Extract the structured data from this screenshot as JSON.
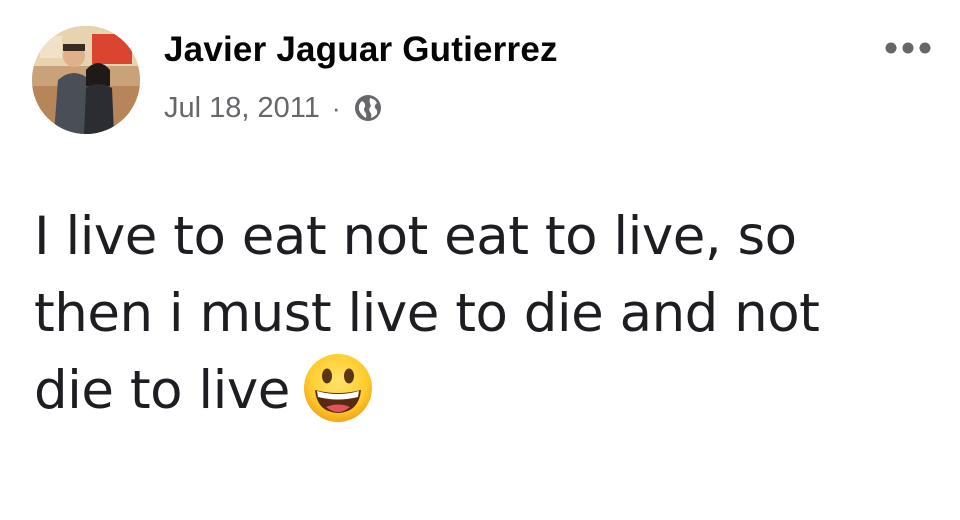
{
  "post": {
    "author_name": "Javier Jaguar Gutierrez",
    "date": "Jul 18, 2011",
    "separator": "·",
    "audience_icon": "globe-icon",
    "more_icon": "more-options-icon",
    "text": "I live to eat not eat to live, so then i must live to die and not die to live",
    "emoji": "grinning-face-emoji"
  },
  "colors": {
    "name": "#050505",
    "meta": "#65676b",
    "body": "#1c1e21",
    "background": "#ffffff"
  }
}
